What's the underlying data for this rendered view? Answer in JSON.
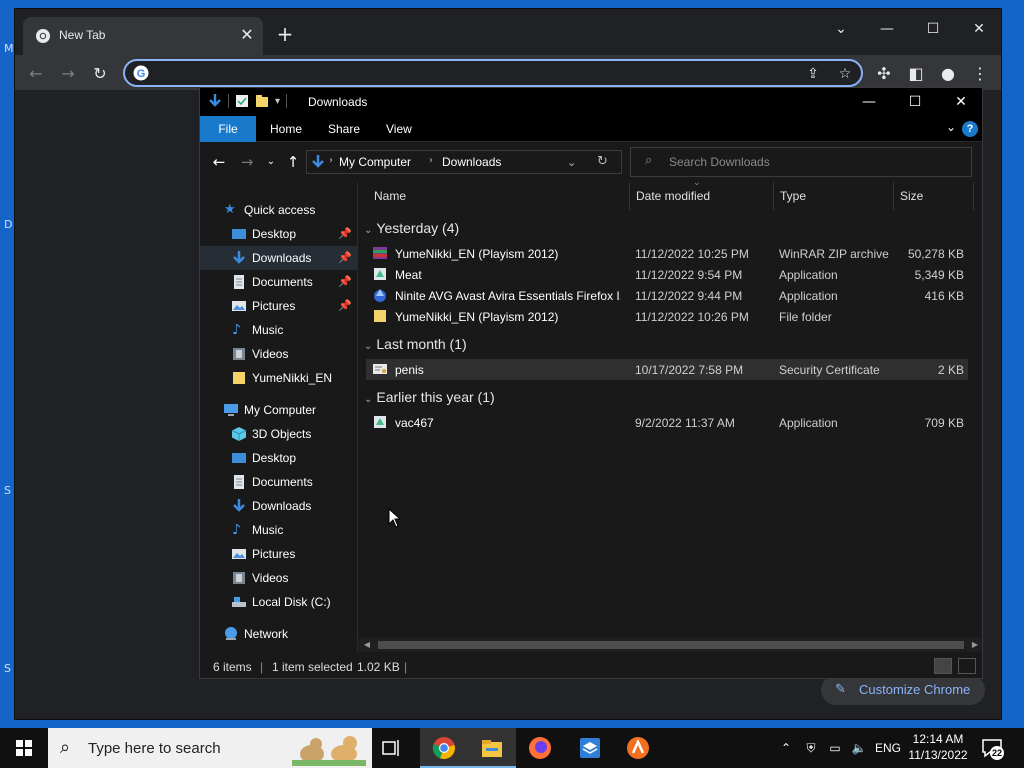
{
  "chrome": {
    "tab_title": "New Tab",
    "omnibox_value": "",
    "customize_label": "Customize Chrome"
  },
  "explorer": {
    "title": "Downloads",
    "ribbon_tabs": [
      "File",
      "Home",
      "Share",
      "View"
    ],
    "breadcrumb": [
      "My Computer",
      "Downloads"
    ],
    "search_placeholder": "Search Downloads",
    "nav": {
      "quick_access": "Quick access",
      "quick_items": [
        "Desktop",
        "Downloads",
        "Documents",
        "Pictures",
        "Music",
        "Videos",
        "YumeNikki_EN"
      ],
      "my_computer": "My Computer",
      "computer_items": [
        "3D Objects",
        "Desktop",
        "Documents",
        "Downloads",
        "Music",
        "Pictures",
        "Videos",
        "Local Disk (C:)"
      ],
      "network": "Network"
    },
    "columns": [
      "Name",
      "Date modified",
      "Type",
      "Size"
    ],
    "groups": [
      {
        "label": "Yesterday (4)",
        "rows": [
          {
            "name": "YumeNikki_EN (Playism 2012)",
            "date": "11/12/2022 10:25 PM",
            "type": "WinRAR ZIP archive",
            "size": "50,278 KB",
            "icon": "winrar-archive-icon"
          },
          {
            "name": "Meat",
            "date": "11/12/2022 9:54 PM",
            "type": "Application",
            "size": "5,349 KB",
            "icon": "installer-icon"
          },
          {
            "name": "Ninite AVG Avast Avira Essentials Firefox I...",
            "date": "11/12/2022 9:44 PM",
            "type": "Application",
            "size": "416 KB",
            "icon": "ninite-icon"
          },
          {
            "name": "YumeNikki_EN (Playism 2012)",
            "date": "11/12/2022 10:26 PM",
            "type": "File folder",
            "size": "",
            "icon": "folder-icon"
          }
        ]
      },
      {
        "label": "Last month (1)",
        "rows": [
          {
            "name": "penis",
            "date": "10/17/2022 7:58 PM",
            "type": "Security Certificate",
            "size": "2 KB",
            "icon": "certificate-icon"
          }
        ]
      },
      {
        "label": "Earlier this year (1)",
        "rows": [
          {
            "name": "vac467",
            "date": "9/2/2022 11:37 AM",
            "type": "Application",
            "size": "709 KB",
            "icon": "installer-icon"
          }
        ]
      }
    ],
    "status": {
      "items": "6 items",
      "selected": "1 item selected",
      "size": "1.02 KB"
    }
  },
  "taskbar": {
    "search_placeholder": "Type here to search",
    "language": "ENG",
    "time": "12:14 AM",
    "date": "11/13/2022",
    "notification_count": "22"
  },
  "colors": {
    "desktop": "#1565c9",
    "accent": "#1979ca",
    "chrome_focus": "#8ab4f8"
  }
}
